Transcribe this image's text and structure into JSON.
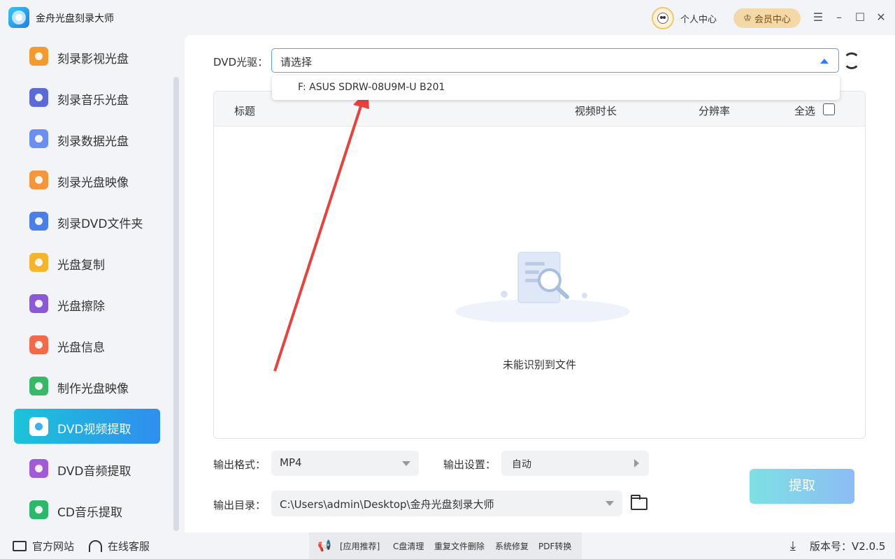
{
  "app": {
    "title": "金舟光盘刻录大师"
  },
  "header": {
    "profile_label": "个人中心",
    "vip_label": "会员中心"
  },
  "window_controls": {
    "menu": "☰",
    "minimize": "–",
    "maximize": "☐",
    "close": "✕"
  },
  "sidebar": {
    "items": [
      {
        "label": "刻录影视光盘",
        "icon": "video-disc-icon",
        "color": "#f29a2e"
      },
      {
        "label": "刻录音乐光盘",
        "icon": "music-disc-icon",
        "color": "#5b6ad6"
      },
      {
        "label": "刻录数据光盘",
        "icon": "data-disc-icon",
        "color": "#6a8ff0"
      },
      {
        "label": "刻录光盘映像",
        "icon": "disc-image-icon",
        "color": "#f6963a"
      },
      {
        "label": "刻录DVD文件夹",
        "icon": "dvd-folder-icon",
        "color": "#4a7ee8"
      },
      {
        "label": "光盘复制",
        "icon": "disc-copy-icon",
        "color": "#f4b42c"
      },
      {
        "label": "光盘擦除",
        "icon": "disc-erase-icon",
        "color": "#8a5ad6"
      },
      {
        "label": "光盘信息",
        "icon": "disc-info-icon",
        "color": "#f26a4a"
      },
      {
        "label": "制作光盘映像",
        "icon": "make-image-icon",
        "color": "#3ab86a"
      },
      {
        "label": "DVD视频提取",
        "icon": "dvd-video-extract-icon",
        "color": "#2aa9e8",
        "active": true
      },
      {
        "label": "DVD音频提取",
        "icon": "dvd-audio-extract-icon",
        "color": "#a35ad6"
      },
      {
        "label": "CD音乐提取",
        "icon": "cd-music-extract-icon",
        "color": "#2ab86a"
      }
    ]
  },
  "drive": {
    "label": "DVD光驱：",
    "placeholder": "请选择",
    "options": [
      "F: ASUS SDRW-08U9M-U B201"
    ]
  },
  "table": {
    "columns": {
      "title": "标题",
      "duration": "视频时长",
      "resolution": "分辨率",
      "select_all": "全选"
    },
    "empty_text": "未能识别到文件"
  },
  "output": {
    "format_label": "输出格式：",
    "format_value": "MP4",
    "settings_label": "输出设置：",
    "settings_value": "自动",
    "dir_label": "输出目录：",
    "dir_value": "C:\\Users\\admin\\Desktop\\金舟光盘刻录大师",
    "extract_label": "提取"
  },
  "footer": {
    "website": "官方网站",
    "support": "在线客服",
    "recommend": [
      "[应用推荐]",
      "C盘清理",
      "重复文件删除",
      "系统修复",
      "PDF转换"
    ],
    "version": "版本号：V2.0.5"
  }
}
